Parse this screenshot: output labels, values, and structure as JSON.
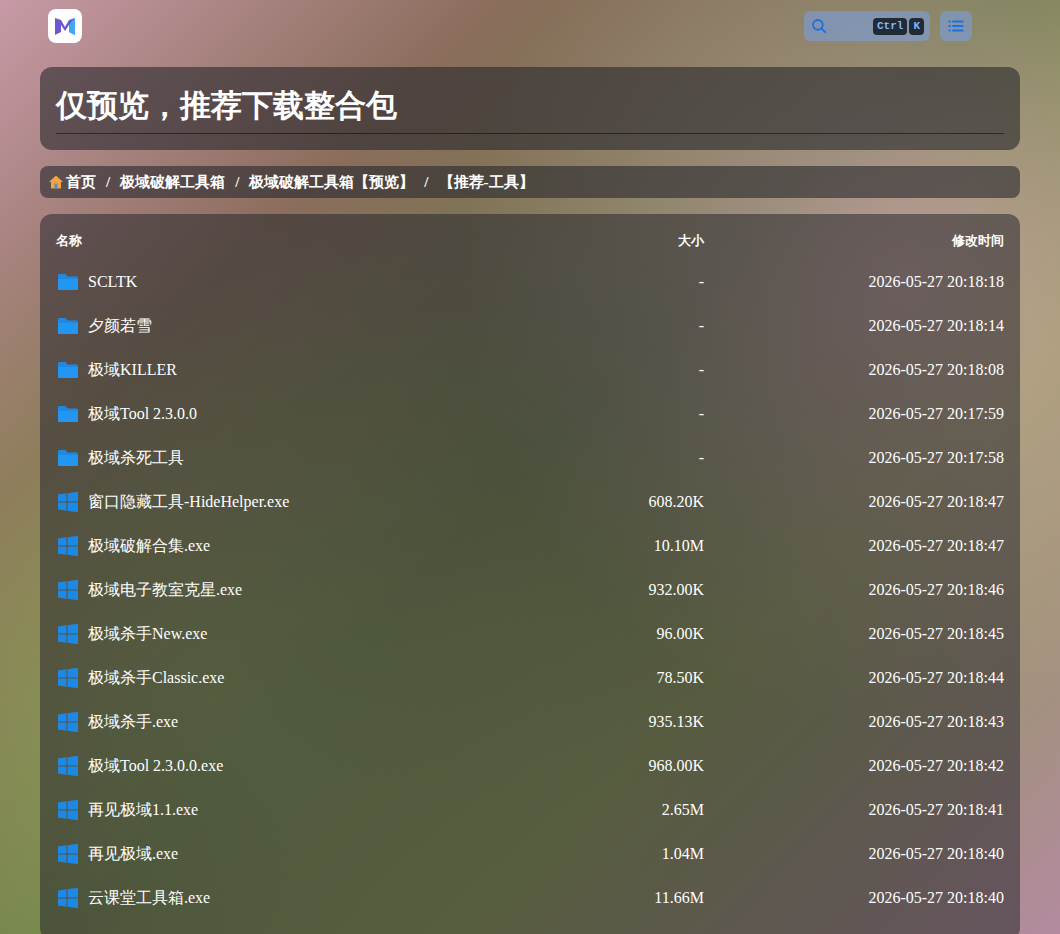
{
  "title": "仅预览，推荐下载整合包",
  "search": {
    "keys": [
      "Ctrl",
      "K"
    ]
  },
  "breadcrumb": {
    "separator": "/",
    "items": [
      "首页",
      "极域破解工具箱",
      "极域破解工具箱【预览】",
      "【推荐-工具】"
    ]
  },
  "table": {
    "columns": [
      "名称",
      "大小",
      "修改时间"
    ],
    "rows": [
      {
        "kind": "folder",
        "name": "SCLTK",
        "size": "-",
        "modified": "2026-05-27 20:18:18"
      },
      {
        "kind": "folder",
        "name": "夕颜若雪",
        "size": "-",
        "modified": "2026-05-27 20:18:14"
      },
      {
        "kind": "folder",
        "name": "极域KILLER",
        "size": "-",
        "modified": "2026-05-27 20:18:08"
      },
      {
        "kind": "folder",
        "name": "极域Tool 2.3.0.0",
        "size": "-",
        "modified": "2026-05-27 20:17:59"
      },
      {
        "kind": "folder",
        "name": "极域杀死工具",
        "size": "-",
        "modified": "2026-05-27 20:17:58"
      },
      {
        "kind": "exe",
        "name": "窗口隐藏工具-HideHelper.exe",
        "size": "608.20K",
        "modified": "2026-05-27 20:18:47"
      },
      {
        "kind": "exe",
        "name": "极域破解合集.exe",
        "size": "10.10M",
        "modified": "2026-05-27 20:18:47"
      },
      {
        "kind": "exe",
        "name": "极域电子教室克星.exe",
        "size": "932.00K",
        "modified": "2026-05-27 20:18:46"
      },
      {
        "kind": "exe",
        "name": "极域杀手New.exe",
        "size": "96.00K",
        "modified": "2026-05-27 20:18:45"
      },
      {
        "kind": "exe",
        "name": "极域杀手Classic.exe",
        "size": "78.50K",
        "modified": "2026-05-27 20:18:44"
      },
      {
        "kind": "exe",
        "name": "极域杀手.exe",
        "size": "935.13K",
        "modified": "2026-05-27 20:18:43"
      },
      {
        "kind": "exe",
        "name": "极域Tool 2.3.0.0.exe",
        "size": "968.00K",
        "modified": "2026-05-27 20:18:42"
      },
      {
        "kind": "exe",
        "name": "再见极域1.1.exe",
        "size": "2.65M",
        "modified": "2026-05-27 20:18:41"
      },
      {
        "kind": "exe",
        "name": "再见极域.exe",
        "size": "1.04M",
        "modified": "2026-05-27 20:18:40"
      },
      {
        "kind": "exe",
        "name": "云课堂工具箱.exe",
        "size": "11.66M",
        "modified": "2026-05-27 20:18:40"
      }
    ]
  }
}
